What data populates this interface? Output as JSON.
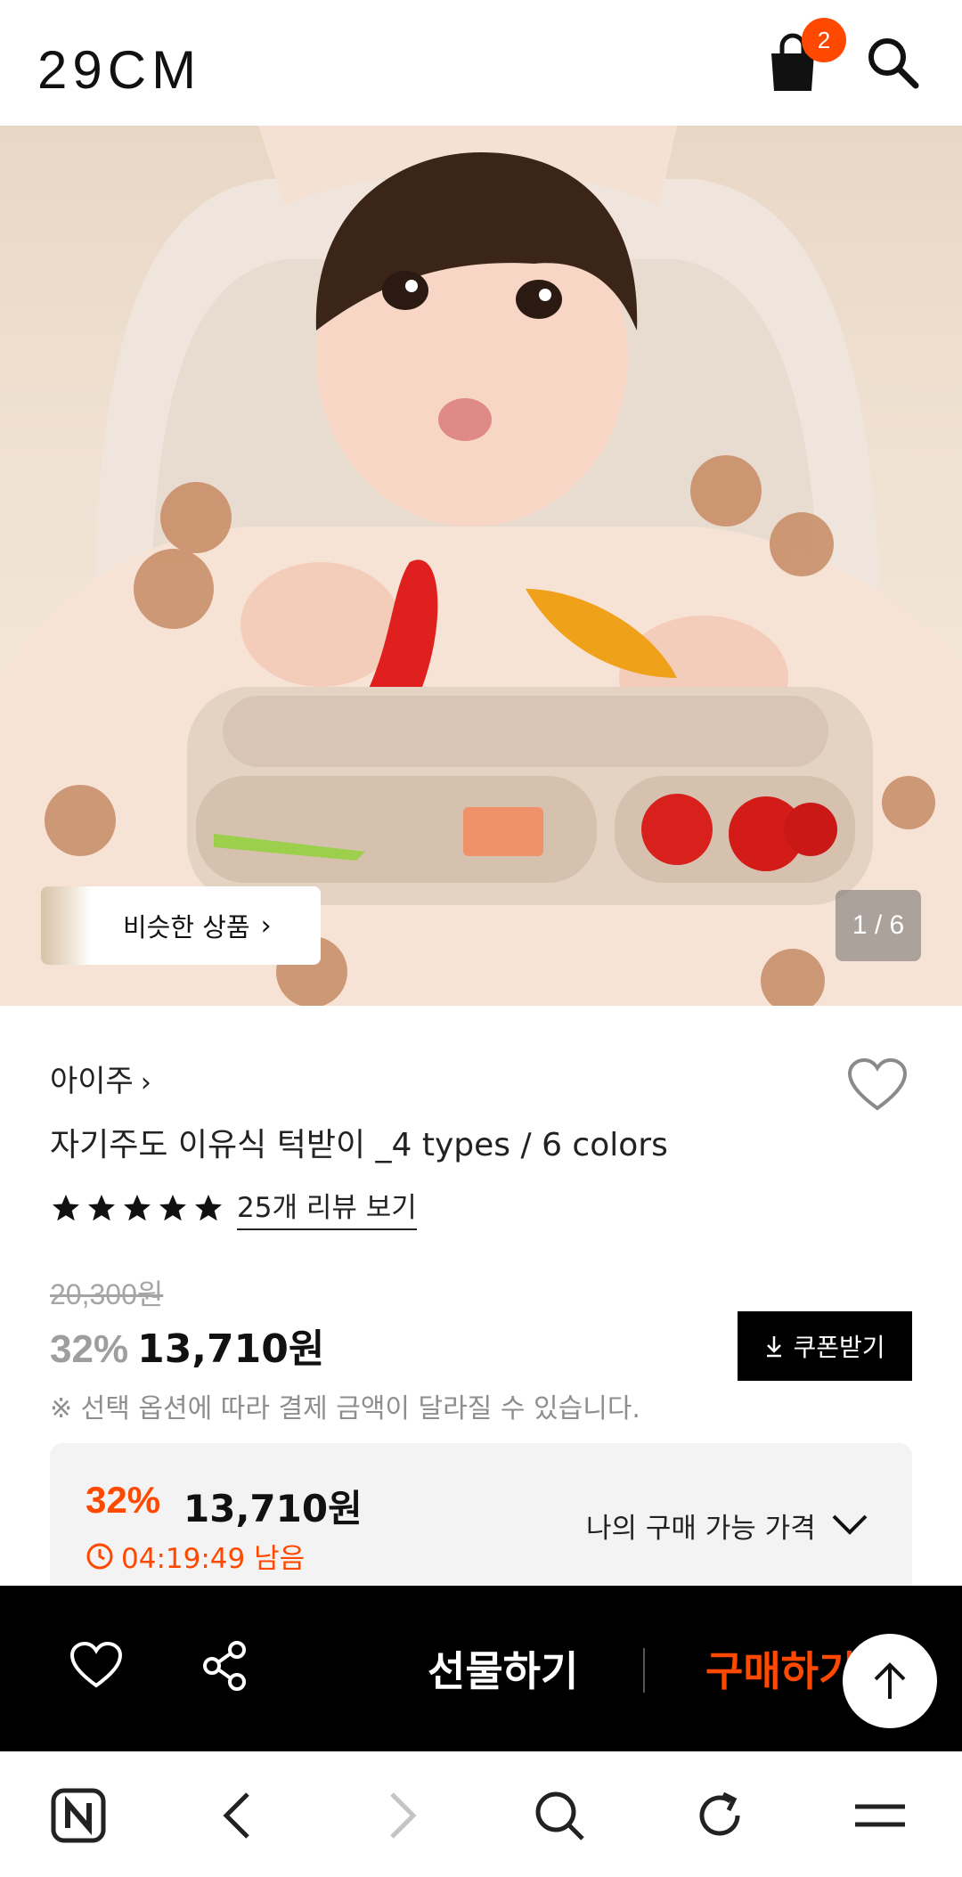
{
  "header": {
    "logo": "29CM",
    "cart_count": "2"
  },
  "hero": {
    "similar_label": "비슷한 상품",
    "similar_chevron": "›",
    "counter": "1 / 6"
  },
  "product": {
    "brand": "아이주",
    "brand_chevron": "›",
    "title": "자기주도 이유식 턱받이 _4 types / 6 colors",
    "rating_stars": 5,
    "review_link": "25개 리뷰 보기",
    "original_price": "20,300원",
    "discount": "32%",
    "sale_price": "13,710원",
    "coupon_label": "쿠폰받기",
    "notice": "※ 선택 옵션에 따라 결제 금액이 달라질 수 있습니다."
  },
  "my_price": {
    "discount": "32%",
    "price": "13,710원",
    "timer": "04:19:49 남음",
    "label": "나의 구매 가능 가격"
  },
  "action_bar": {
    "gift_label": "선물하기",
    "buy_label": "구매하기"
  },
  "colors": {
    "accent": "#ff4800",
    "black": "#000000",
    "gray_text": "#8e8e8e"
  },
  "icons": [
    "cart-icon",
    "search-icon",
    "heart-icon",
    "share-icon",
    "arrow-up-icon",
    "naver-icon",
    "back-icon",
    "forward-icon",
    "refresh-icon",
    "menu-icon",
    "download-icon",
    "clock-icon",
    "chevron-down-icon",
    "star-icon"
  ]
}
